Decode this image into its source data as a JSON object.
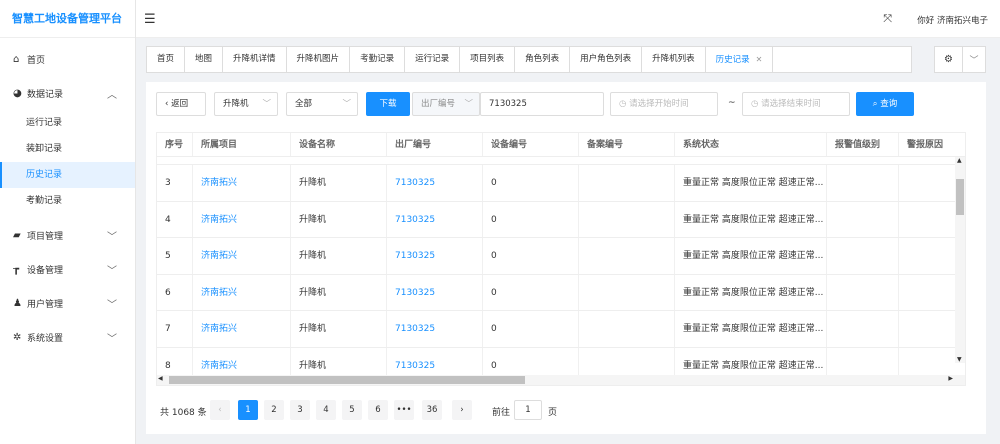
{
  "app_title": "智慧工地设备管理平台",
  "user_greeting": "你好 济南拓兴电子",
  "menu": {
    "home": "首页",
    "data_records": "数据记录",
    "sub": [
      "运行记录",
      "装卸记录",
      "历史记录",
      "考勤记录"
    ],
    "project": "项目管理",
    "device": "设备管理",
    "user": "用户管理",
    "system": "系统设置"
  },
  "tabs": [
    "首页",
    "地图",
    "升降机详情",
    "升降机图片",
    "考勤记录",
    "运行记录",
    "项目列表",
    "角色列表",
    "用户角色列表",
    "升降机列表",
    "历史记录"
  ],
  "filter": {
    "back": "‹ 返回",
    "type": "升降机",
    "scope": "全部",
    "download": "下载",
    "field": "出厂编号",
    "value": "7130325",
    "start_ph": "请选择开始时间",
    "tilde": "~",
    "end_ph": "请选择结束时间",
    "search": "查询"
  },
  "table": {
    "headers": [
      "序号",
      "所属项目",
      "设备名称",
      "出厂编号",
      "设备编号",
      "备案编号",
      "系统状态",
      "报警值级别",
      "警报原因"
    ],
    "rows": [
      [
        "3",
        "济南拓兴",
        "升降机",
        "7130325",
        "0",
        "",
        "重量正常 高度限位正常 超速正常..."
      ],
      [
        "4",
        "济南拓兴",
        "升降机",
        "7130325",
        "0",
        "",
        "重量正常 高度限位正常 超速正常..."
      ],
      [
        "5",
        "济南拓兴",
        "升降机",
        "7130325",
        "0",
        "",
        "重量正常 高度限位正常 超速正常..."
      ],
      [
        "6",
        "济南拓兴",
        "升降机",
        "7130325",
        "0",
        "",
        "重量正常 高度限位正常 超速正常..."
      ],
      [
        "7",
        "济南拓兴",
        "升降机",
        "7130325",
        "0",
        "",
        "重量正常 高度限位正常 超速正常..."
      ],
      [
        "8",
        "济南拓兴",
        "升降机",
        "7130325",
        "0",
        "",
        "重量正常 高度限位正常 超速正常..."
      ]
    ]
  },
  "pager": {
    "total": "共 1068 条",
    "prev": "‹",
    "pages": [
      "1",
      "2",
      "3",
      "4",
      "5",
      "6",
      "•••",
      "36"
    ],
    "next": "›",
    "goto": "前往",
    "page_value": "1",
    "page_unit": "页"
  },
  "colors": {
    "accent": "#1890ff"
  }
}
